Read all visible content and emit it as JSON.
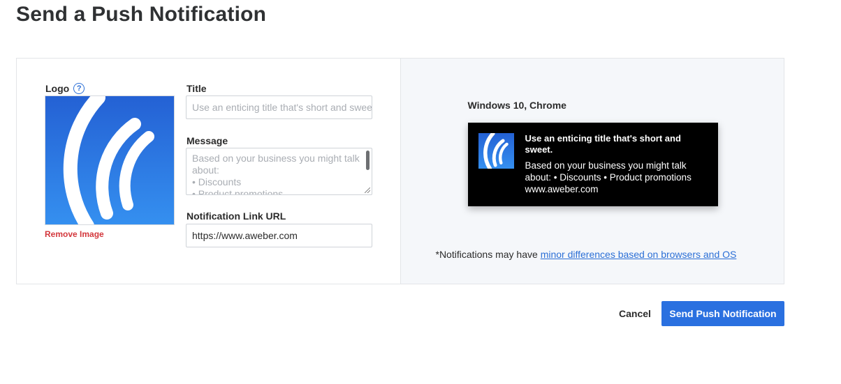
{
  "page": {
    "title": "Send a Push Notification"
  },
  "logo": {
    "label": "Logo",
    "help_icon": "?",
    "remove_label": "Remove Image",
    "icon": "aweber-waves-icon"
  },
  "form": {
    "title_label": "Title",
    "title_placeholder": "Use an enticing title that's short and sweet.",
    "message_label": "Message",
    "message_placeholder_lines": [
      "Based on your business you might talk about:",
      "• Discounts",
      "• Product promotions"
    ],
    "link_label": "Notification Link URL",
    "link_value": "https://www.aweber.com"
  },
  "preview": {
    "platform": "Windows 10, Chrome",
    "notification": {
      "title": "Use an enticing title that's short and sweet.",
      "body": "Based on your business you might talk about: • Discounts • Product promotions",
      "url": "www.aweber.com"
    },
    "disclaimer_prefix": "*Notifications may have ",
    "disclaimer_link": "minor differences based on browsers and OS"
  },
  "actions": {
    "cancel_label": "Cancel",
    "send_label": "Send Push Notification"
  },
  "colors": {
    "primary": "#2a70e0",
    "danger": "#d3373c",
    "preview_bg": "#f5f7fa",
    "notification_bg": "#000000"
  }
}
